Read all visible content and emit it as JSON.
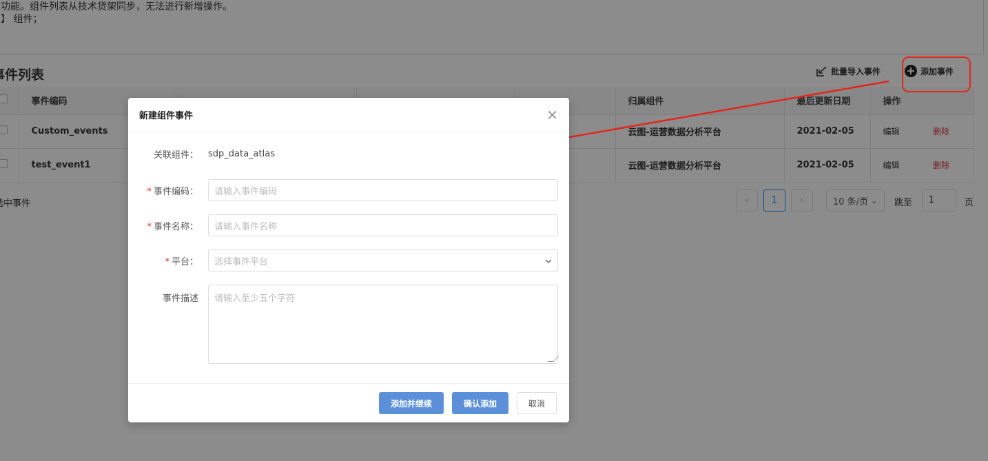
{
  "description": {
    "line1": "功能。组件列表从技术货架同步，无法进行新增操作。",
    "line2": "】 组件；"
  },
  "section": {
    "title": "事件列表",
    "batch_import_label": "批量导入事件",
    "add_event_label": "添加事件",
    "batch_icon": "import-icon",
    "add_icon": "plus-circle-icon"
  },
  "table": {
    "headers": [
      "事件编码",
      "",
      "",
      "",
      "归属组件",
      "最后更新日期",
      "操作"
    ],
    "rows": [
      {
        "code": "Custom_events",
        "component": "云图-运营数据分析平台",
        "date": "2021-02-05",
        "edit": "编辑",
        "delete": "删除"
      },
      {
        "code": "test_event1",
        "component": "云图-运营数据分析平台",
        "date": "2021-02-05",
        "edit": "编辑",
        "delete": "删除"
      }
    ]
  },
  "selected_note": "选中事件",
  "pagination": {
    "prev": "‹",
    "current": "1",
    "next": "›",
    "page_size": "10 条/页",
    "jump_label": "跳至",
    "jump_value": "1",
    "unit": "页"
  },
  "modal": {
    "title": "新建组件事件",
    "fields": {
      "component_label": "关联组件：",
      "component_value": "sdp_data_atlas",
      "code_label": "事件编码：",
      "code_placeholder": "请输入事件编码",
      "name_label": "事件名称：",
      "name_placeholder": "请输入事件名称",
      "platform_label": "平台：",
      "platform_placeholder": "选择事件平台",
      "desc_label": "事件描述",
      "desc_placeholder": "请输入至少五个字符"
    },
    "buttons": {
      "add_continue": "添加并继续",
      "confirm": "确认添加",
      "cancel": "取消"
    }
  },
  "colors": {
    "primary": "#5b8fd8",
    "danger": "#d9363e",
    "annotation": "#e2261c"
  }
}
